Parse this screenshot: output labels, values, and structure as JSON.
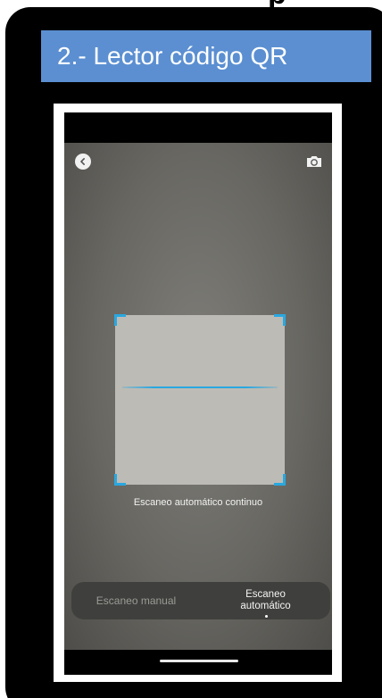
{
  "slide": {
    "title": "2.- Lector código QR",
    "top_fragment": "p"
  },
  "scanner": {
    "caption": "Escaneo automático continuo",
    "modes": {
      "manual_label": "Escaneo manual",
      "auto_line1": "Escaneo",
      "auto_line2": "automático",
      "selected": "auto"
    },
    "icons": {
      "back": "back-arrow-icon",
      "camera": "camera-flip-icon"
    },
    "colors": {
      "accent": "#29a8e0",
      "banner": "#5b8fd1"
    }
  }
}
